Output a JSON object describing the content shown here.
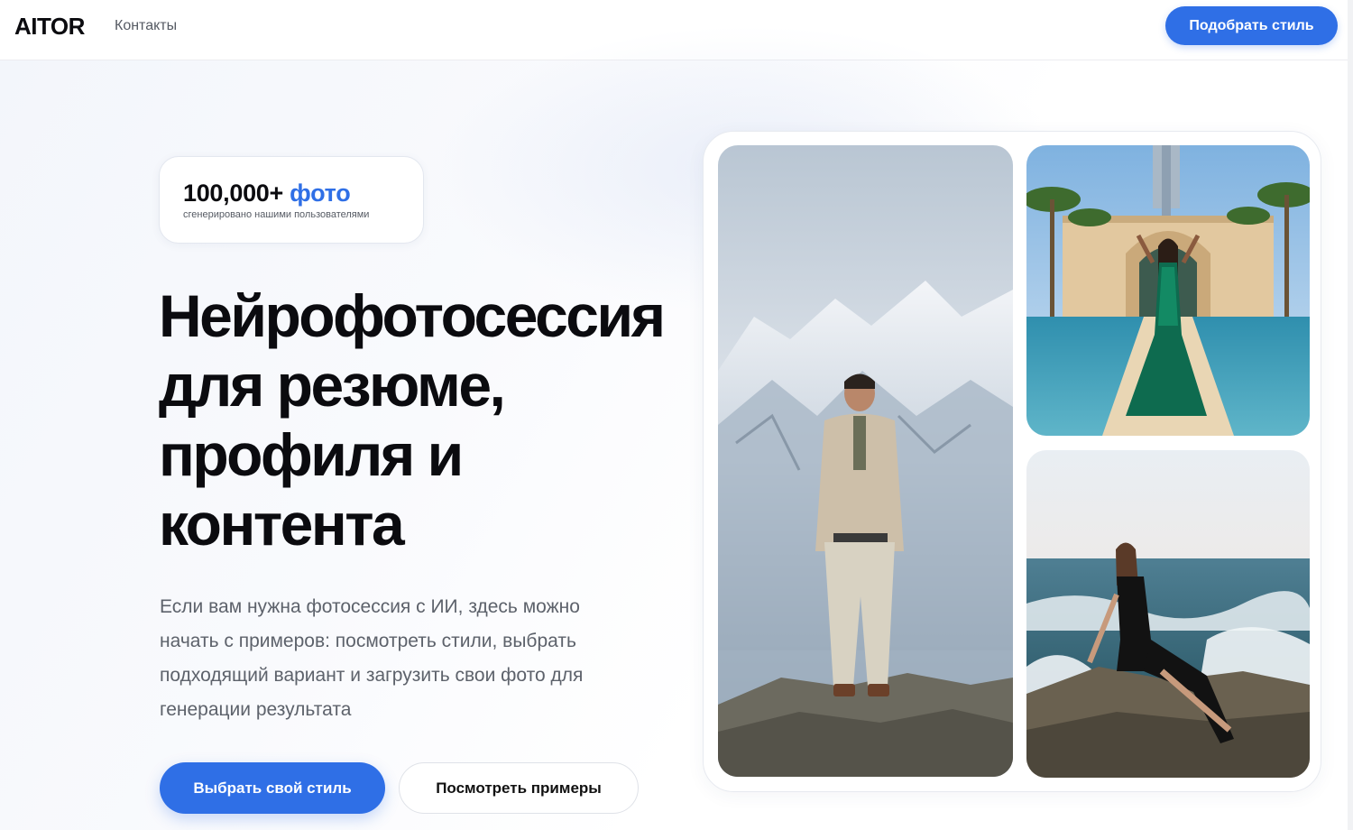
{
  "header": {
    "logo": "AITOR",
    "nav": {
      "contacts": "Контакты"
    },
    "cta": "Подобрать стиль"
  },
  "hero": {
    "stat": {
      "number": "100,000+",
      "word": "фото",
      "caption": "сгенерировано нашими пользователями"
    },
    "headline": [
      "Нейрофотосессия",
      "для резюме,",
      "профиля и",
      "контента"
    ],
    "description": "Если вам нужна фотосессия с ИИ, здесь можно начать с примеров: посмотреть стили, выбрать подходящий вариант и загрузить свои фото для генерации результата",
    "buttons": {
      "primary": "Выбрать свой стиль",
      "secondary": "Посмотреть примеры"
    }
  },
  "gallery": {
    "photos": [
      {
        "subject": "man-mountain-photo"
      },
      {
        "subject": "woman-palace-pool-photo"
      },
      {
        "subject": "woman-sea-rocks-photo"
      }
    ]
  },
  "colors": {
    "accent": "#2f6fe6",
    "text": "#0b0b0f",
    "muted": "#5d626b"
  }
}
